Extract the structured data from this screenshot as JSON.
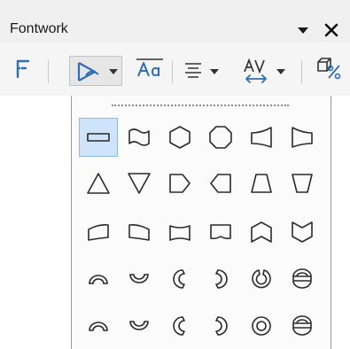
{
  "window": {
    "title": "Fontwork"
  },
  "toolbar": {
    "items": [
      {
        "name": "fontwork-gallery",
        "icon": "fontwork-gallery-icon"
      },
      {
        "name": "fontwork-shape",
        "icon": "fontwork-shape-icon",
        "has_dropdown": true
      },
      {
        "name": "same-letter-heights",
        "icon": "same-letter-heights-icon"
      },
      {
        "name": "alignment",
        "icon": "align-icon",
        "has_dropdown": true
      },
      {
        "name": "character-spacing",
        "icon": "character-spacing-icon",
        "has_dropdown": true
      },
      {
        "name": "extrusion-toggle",
        "icon": "extrusion-icon"
      }
    ],
    "colors": {
      "accent": "#2f6db5",
      "text": "#333333"
    }
  },
  "shape_popup": {
    "selected_index": 0,
    "shapes": [
      "plain-text",
      "wave",
      "hexagon",
      "octagon",
      "curved-trapezoid-right",
      "curved-trapezoid-left",
      "triangle-up",
      "triangle-down",
      "arrow-right-pentagon",
      "arrow-left-pentagon",
      "trapezoid-up",
      "trapezoid-down",
      "inflate-left",
      "inflate-right",
      "inflate-top",
      "inflate-bottom",
      "chevron-up",
      "chevron-down",
      "arch-up",
      "arch-down",
      "arch-left",
      "arch-right",
      "circle-open",
      "button-open",
      "arch-up-curve",
      "arch-down-curve",
      "arch-left-curve",
      "arch-right-curve",
      "circle-curve",
      "button-curve"
    ]
  }
}
